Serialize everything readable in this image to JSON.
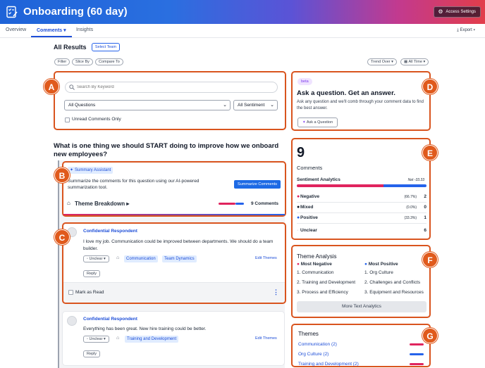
{
  "header": {
    "title": "Onboarding (60 day)",
    "access_settings": "Access Settings"
  },
  "nav": {
    "tabs": [
      {
        "label": "Overview"
      },
      {
        "label": "Comments"
      },
      {
        "label": "Insights"
      }
    ],
    "export": "Export"
  },
  "results": {
    "title": "All Results",
    "select_team": "Select Team"
  },
  "toolbar": {
    "filter": "Filter",
    "slice_by": "Slice By",
    "compare_to": "Compare To",
    "trend_over": "Trend Over",
    "all_time": "All Time"
  },
  "markers": [
    "A",
    "B",
    "C",
    "D",
    "E",
    "F",
    "G"
  ],
  "search": {
    "placeholder": "Search By Keyword",
    "questions_select": "All Questions",
    "sentiment_select": "All Sentiment",
    "unread_label": "Unread Comments Only"
  },
  "question": {
    "text": "What is one thing we should START doing to improve how we onboard new employees?"
  },
  "summary": {
    "badge": "Summary Assistant",
    "description": "Summarize the comments for this question using our AI-powered summarization tool.",
    "button": "Summarize Comments",
    "theme_breakdown": "Theme Breakdown",
    "comment_count": "9 Comments"
  },
  "comments": [
    {
      "author": "Confidential Respondent",
      "text": "I love my job. Communication could be improved between departments. We should do a team builder.",
      "sentiment": "Unclear",
      "tags": [
        "Communication",
        "Team Dynamics"
      ],
      "edit": "Edit Themes",
      "reply": "Reply",
      "mark_read": "Mark as Read"
    },
    {
      "author": "Confidential Respondent",
      "text": "Everything has been great. New hire training could be better.",
      "sentiment": "Unclear",
      "tags": [
        "Training and Development"
      ],
      "edit": "Edit Themes",
      "reply": "Reply"
    }
  ],
  "ask": {
    "beta": "beta",
    "title": "Ask a question. Get an answer.",
    "description": "Ask any question and we'll comb through your comment data to find the best answer.",
    "button": "Ask a Question"
  },
  "stats": {
    "count": "9",
    "label": "Comments",
    "sentiment_title": "Sentiment Analytics",
    "net": "Net -33.33",
    "rows": [
      {
        "label": "Negative",
        "pct": "(66.7%)",
        "value": "2",
        "color": "#e0245e"
      },
      {
        "label": "Mixed",
        "pct": "(0.0%)",
        "value": "0",
        "color": "#111827"
      },
      {
        "label": "Positive",
        "pct": "(33.3%)",
        "value": "1",
        "color": "#2563eb"
      },
      {
        "label": "Unclear",
        "pct": "",
        "value": "6",
        "color": "#9ca3af"
      }
    ],
    "bar": {
      "negative": 0.667,
      "positive": 0.333
    }
  },
  "theme_analysis": {
    "title": "Theme Analysis",
    "neg_title": "Most Negative",
    "pos_title": "Most Positive",
    "negative": [
      "1. Communication",
      "2. Training and Development",
      "3. Process and Efficiency"
    ],
    "positive": [
      "1. Org Culture",
      "2. Challenges and Conflicts",
      "3. Equipment and Resources"
    ],
    "button": "More Text Analytics"
  },
  "themes": {
    "title": "Themes",
    "items": [
      {
        "label": "Communication  (2)",
        "color": "#e0245e"
      },
      {
        "label": "Org Culture  (2)",
        "color": "#2563eb"
      },
      {
        "label": "Training and Development  (2)",
        "color": "#e0245e"
      }
    ]
  },
  "colors": {
    "accent": "#1d4ed8",
    "marker": "#e05a1c",
    "negative": "#e0245e",
    "positive": "#2563eb"
  }
}
